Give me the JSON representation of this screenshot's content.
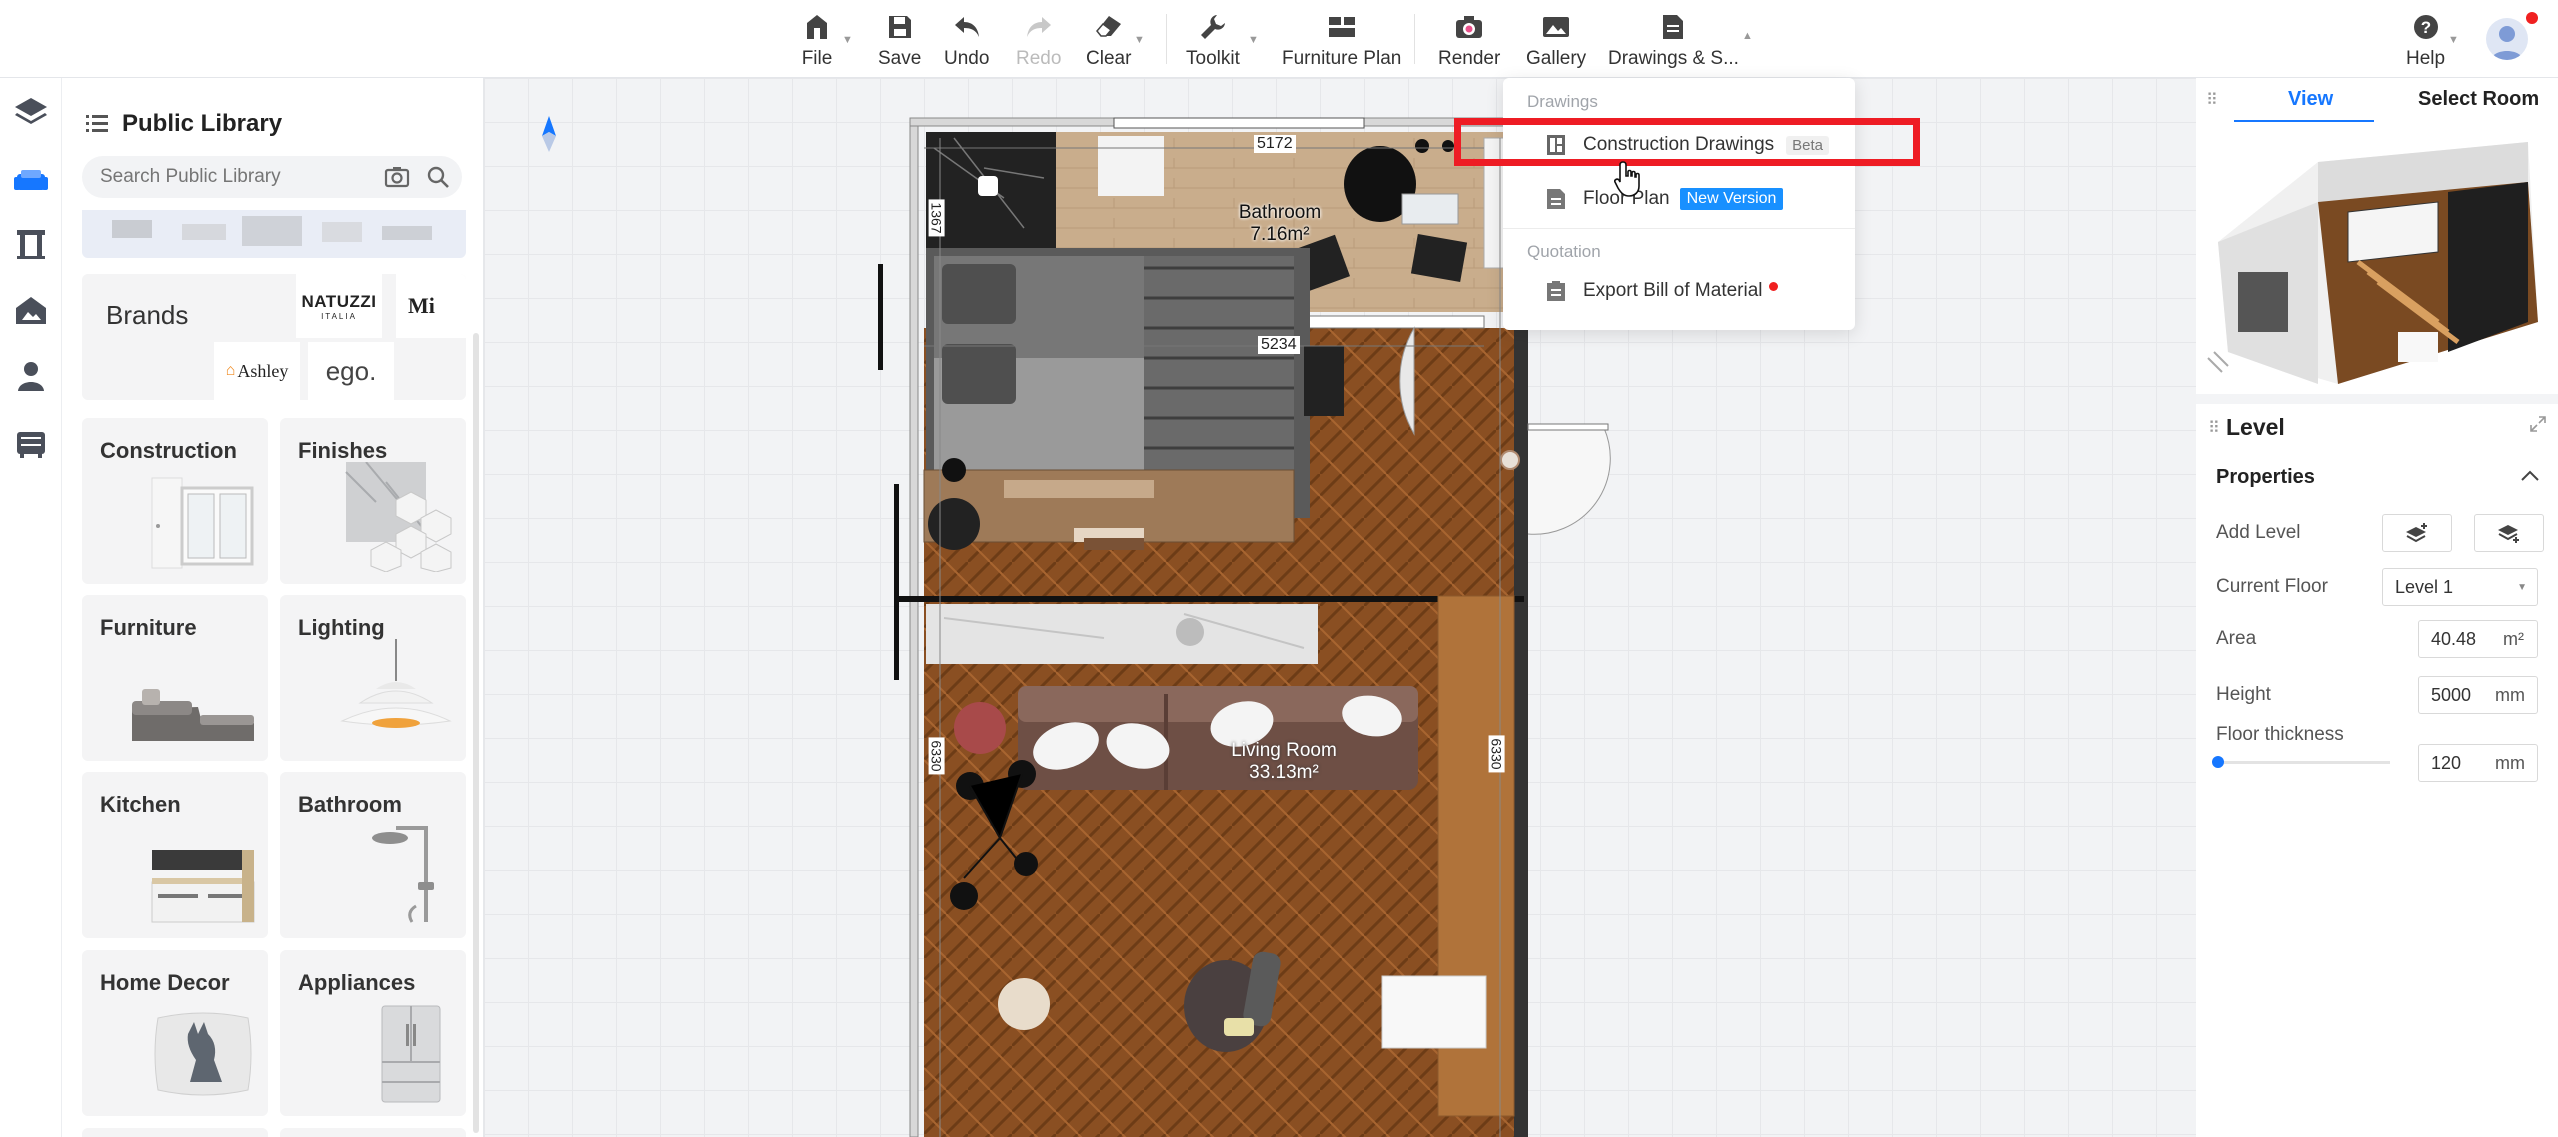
{
  "toolbar": {
    "file": "File",
    "save": "Save",
    "undo": "Undo",
    "redo": "Redo",
    "clear": "Clear",
    "toolkit": "Toolkit",
    "furniture_plan": "Furniture Plan",
    "render": "Render",
    "gallery": "Gallery",
    "drawings": "Drawings & S...",
    "help": "Help"
  },
  "library": {
    "title": "Public Library",
    "search_placeholder": "Search Public Library",
    "brands_label": "Brands",
    "brands": [
      "NATUZZI",
      "ITALIA",
      "Mi",
      "Ashley",
      "ego."
    ],
    "categories": [
      {
        "label": "Construction"
      },
      {
        "label": "Finishes"
      },
      {
        "label": "Furniture"
      },
      {
        "label": "Lighting"
      },
      {
        "label": "Kitchen"
      },
      {
        "label": "Bathroom"
      },
      {
        "label": "Home Decor"
      },
      {
        "label": "Appliances"
      }
    ]
  },
  "floorplan": {
    "bathroom_name": "Bathroom",
    "bathroom_area": "7.16m²",
    "living_name": "Living Room",
    "living_area": "33.13m²",
    "dim_top": "5172",
    "dim_mid": "5234",
    "dim_left_top": "1367",
    "dim_left": "6330",
    "dim_right": "6330"
  },
  "dropdown": {
    "section_drawings": "Drawings",
    "construction": "Construction Drawings",
    "beta": "Beta",
    "floor_plan": "Floor Plan",
    "new_version": "New Version",
    "section_quotation": "Quotation",
    "export_bom": "Export Bill of Material"
  },
  "view_panel": {
    "tab_view": "View",
    "tab_select_room": "Select Room"
  },
  "level_panel": {
    "title": "Level",
    "properties": "Properties",
    "add_level": "Add Level",
    "current_floor_label": "Current Floor",
    "current_floor_value": "Level 1",
    "area_label": "Area",
    "area_value": "40.48",
    "area_unit": "m²",
    "height_label": "Height",
    "height_value": "5000",
    "height_unit": "mm",
    "thickness_label": "Floor thickness",
    "thickness_value": "120",
    "thickness_unit": "mm"
  },
  "colors": {
    "accent": "#1677ff",
    "highlight": "#ee1c24",
    "wood": "#8a4f22",
    "new_tag": "#1890ff"
  }
}
